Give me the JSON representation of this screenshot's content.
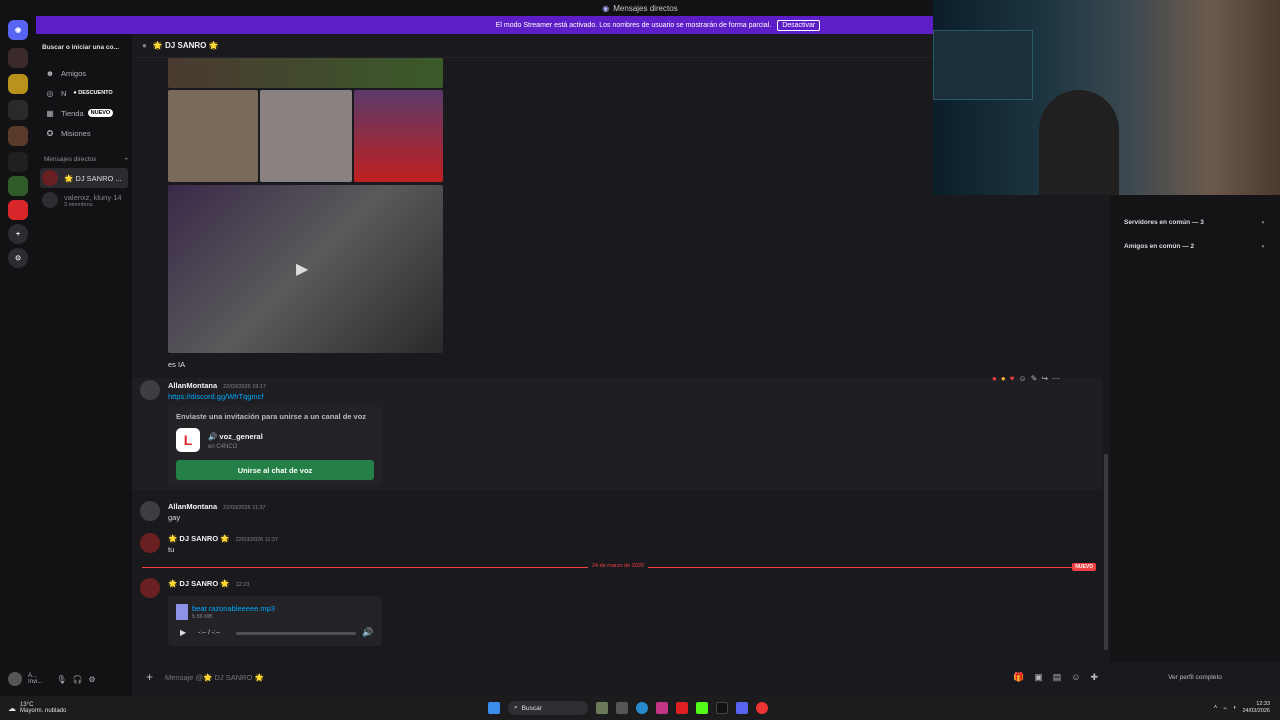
{
  "window": {
    "title": "Mensajes directos"
  },
  "banner": {
    "text": "El modo Streamer está activado. Los nombres de usuario se mostrarán de forma parcial.",
    "button": "Desactivar"
  },
  "sidebar": {
    "search": "Buscar o iniciar una co...",
    "nav": [
      {
        "label": "Amigos",
        "icon": "friends-icon"
      },
      {
        "label": "N",
        "badge": "DESCUENTO",
        "icon": "nitro-icon"
      },
      {
        "label": "Tienda",
        "badge": "NUEVO",
        "icon": "shop-icon"
      },
      {
        "label": "Misiones",
        "icon": "quests-icon"
      }
    ],
    "dm_header": "Mensajes directos",
    "dms": [
      {
        "name": "🌟 DJ SANRO ..."
      },
      {
        "name": "valenxz, kluny 14",
        "sub": "3 miembros"
      }
    ]
  },
  "user": {
    "name": "A...",
    "status": "Invi..."
  },
  "chat": {
    "header": "🌟 DJ SANRO 🌟",
    "messages": [
      {
        "text": "es IA"
      },
      {
        "author": "AllanMontana",
        "time": "22/03/2026 19:17",
        "link": "https://discord.gg/WhTqgmcf"
      },
      {
        "author": "AllanMontana",
        "time": "22/03/2026 11:37",
        "text": "gay"
      },
      {
        "author": "🌟 DJ SANRO 🌟",
        "time": "22/03/2026 11:37",
        "text": "tu"
      },
      {
        "author": "🌟 DJ SANRO 🌟",
        "time": "12:23"
      }
    ],
    "invite": {
      "title": "Enviaste una invitación para unirse a un canal de voz",
      "channel": "🔊 voz_general",
      "server": "en C4NCO",
      "button": "Unirse al chat de voz"
    },
    "divider": {
      "date": "24 de marzo de 2026",
      "badge": "NUEVO"
    },
    "file": {
      "name": "beat razonableeeee.mp3",
      "size": "5.56 MB",
      "time": "-:-- / -:--"
    },
    "composer_placeholder": "Mensaje @🌟 DJ SANRO 🌟"
  },
  "profile_panel": {
    "rows": [
      "Servidores en común — 3",
      "Amigos en común — 2"
    ],
    "footer": "Ver perfil completo"
  },
  "taskbar": {
    "weather_temp": "13°C",
    "weather_text": "Mayorm. nublado",
    "search": "Buscar",
    "time": "12:33",
    "date": "24/03/2026"
  }
}
